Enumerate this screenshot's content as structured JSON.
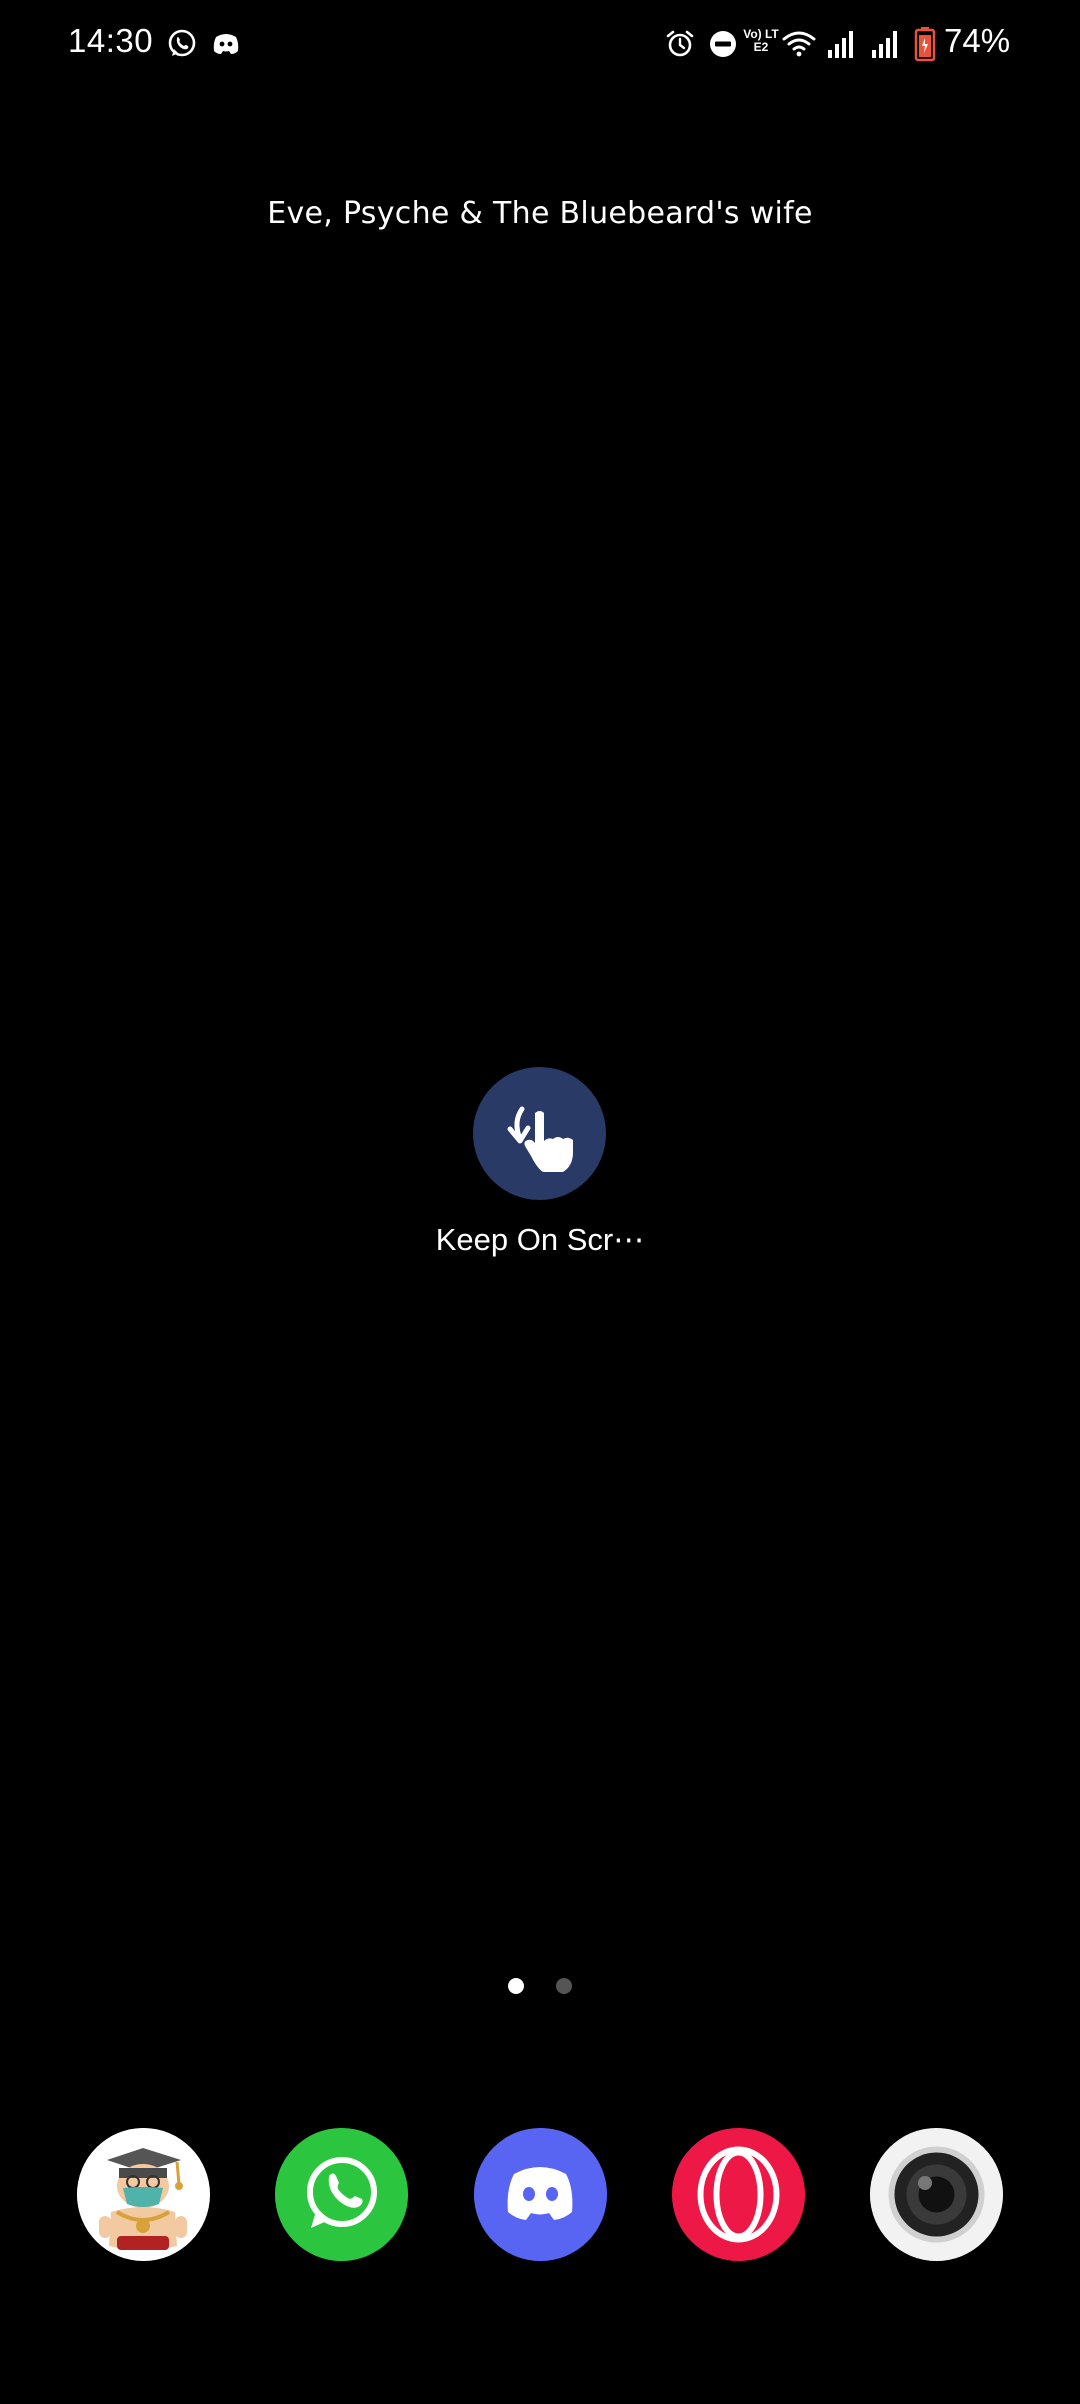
{
  "status_bar": {
    "time": "14:30",
    "battery_percent": "74%",
    "network_label": "Vo) LTE2",
    "notifications": [
      "whatsapp-icon",
      "discord-icon"
    ],
    "system_icons": [
      "alarm-icon",
      "do-not-disturb-icon",
      "volte-icon",
      "wifi-icon",
      "signal-icon",
      "signal-icon",
      "battery-icon"
    ]
  },
  "widget": {
    "title": "Eve, Psyche & The Bluebeard's wife"
  },
  "home": {
    "center_app": {
      "label": "Keep On Scr⋯",
      "icon": "touch-gesture-icon"
    },
    "pages": {
      "count": 2,
      "active": 1
    }
  },
  "dock": {
    "apps": [
      {
        "icon": "avatar-sticker-icon"
      },
      {
        "icon": "whatsapp-icon",
        "color": "#2cc53f"
      },
      {
        "icon": "discord-icon",
        "color": "#5865f2"
      },
      {
        "icon": "opera-icon",
        "color": "#ee1846"
      },
      {
        "icon": "camera-icon",
        "color": "#f2f2f2"
      }
    ]
  },
  "colors": {
    "background": "#000000",
    "center_icon_bg": "#2a3a66",
    "battery_low": "#e8533a"
  }
}
